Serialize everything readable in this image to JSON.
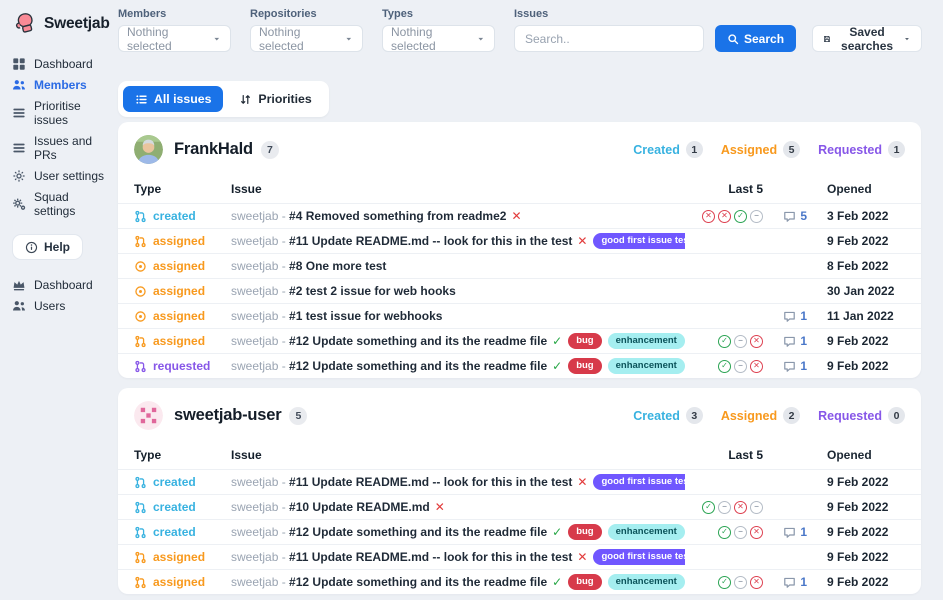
{
  "app": {
    "title": "Sweetjab"
  },
  "colors": {
    "accent": "#1a73e8",
    "created": "#38b2e0",
    "assigned": "#f8991d",
    "requested": "#8757e8"
  },
  "ui_icons": {
    "caret": "caret-down-icon",
    "search": "search-icon",
    "save": "save-icon",
    "comment": "comment-icon"
  },
  "sidebar": {
    "logo_icon": "boxing-glove-icon",
    "nav": [
      {
        "label": "Dashboard",
        "icon": "grid-icon",
        "active": false
      },
      {
        "label": "Members",
        "icon": "users-icon",
        "active": true
      },
      {
        "label": "Prioritise issues",
        "icon": "lines-icon",
        "active": false
      },
      {
        "label": "Issues and PRs",
        "icon": "lines-icon",
        "active": false
      },
      {
        "label": "User settings",
        "icon": "gear-icon",
        "active": false
      },
      {
        "label": "Squad settings",
        "icon": "gears-icon",
        "active": false
      }
    ],
    "help": {
      "label": "Help",
      "icon": "info-icon"
    },
    "admin": [
      {
        "label": "Dashboard",
        "icon": "crown-icon",
        "active": false
      },
      {
        "label": "Users",
        "icon": "users-icon",
        "active": false
      }
    ]
  },
  "filters": {
    "members": {
      "label": "Members",
      "value": "Nothing selected"
    },
    "repositories": {
      "label": "Repositories",
      "value": "Nothing selected"
    },
    "types": {
      "label": "Types",
      "value": "Nothing selected"
    },
    "issues": {
      "label": "Issues",
      "placeholder": "Search.."
    },
    "search_button": "Search",
    "saved_searches": "Saved searches"
  },
  "tabs": [
    {
      "label": "All issues",
      "icon": "list-check-icon",
      "active": true
    },
    {
      "label": "Priorities",
      "icon": "sort-icon",
      "active": false
    }
  ],
  "table_columns": [
    "Type",
    "Issue",
    "Last 5",
    "Opened"
  ],
  "label_palette": {
    "bug": {
      "bg": "#d73a4a",
      "fg": "#ffffff"
    },
    "enhancement": {
      "bg": "#a5eef0",
      "fg": "#0b535a"
    },
    "good first issue test": {
      "bg": "#7057ff",
      "fg": "#ffffff"
    }
  },
  "users": [
    {
      "name": "FrankHald",
      "issue_count": "7",
      "avatar": "photo-avatar",
      "stats": [
        {
          "label": "Created",
          "value": "1"
        },
        {
          "label": "Assigned",
          "value": "5"
        },
        {
          "label": "Requested",
          "value": "1"
        }
      ],
      "rows": [
        {
          "type": "created",
          "icon": "pull-request-icon",
          "repo": "sweetjab",
          "title": "#4 Removed something from readme2",
          "mark": "x",
          "labels": [],
          "checks": [
            "x",
            "x",
            "check",
            "minus"
          ],
          "comments": "5",
          "opened": "3 Feb 2022"
        },
        {
          "type": "assigned",
          "icon": "pull-request-icon",
          "repo": "sweetjab",
          "title": "#11 Update README.md -- look for this in the test",
          "mark": "x",
          "labels": [
            "good first issue test"
          ],
          "checks": [],
          "comments": "",
          "opened": "9 Feb 2022"
        },
        {
          "type": "assigned",
          "icon": "issue-icon",
          "repo": "sweetjab",
          "title": "#8 One more test",
          "mark": "",
          "labels": [],
          "checks": [],
          "comments": "",
          "opened": "8 Feb 2022"
        },
        {
          "type": "assigned",
          "icon": "issue-icon",
          "repo": "sweetjab",
          "title": "#2 test 2 issue for web hooks",
          "mark": "",
          "labels": [],
          "checks": [],
          "comments": "",
          "opened": "30 Jan 2022"
        },
        {
          "type": "assigned",
          "icon": "issue-icon",
          "repo": "sweetjab",
          "title": "#1 test issue for webhooks",
          "mark": "",
          "labels": [],
          "checks": [],
          "comments": "1",
          "opened": "11 Jan 2022"
        },
        {
          "type": "assigned",
          "icon": "pull-request-icon",
          "repo": "sweetjab",
          "title": "#12 Update something and its the readme file",
          "mark": "check",
          "labels": [
            "bug",
            "enhancement"
          ],
          "checks": [
            "check",
            "minus",
            "x"
          ],
          "comments": "1",
          "opened": "9 Feb 2022"
        },
        {
          "type": "requested",
          "icon": "pull-request-icon",
          "repo": "sweetjab",
          "title": "#12 Update something and its the readme file",
          "mark": "check",
          "labels": [
            "bug",
            "enhancement"
          ],
          "checks": [
            "check",
            "minus",
            "x"
          ],
          "comments": "1",
          "opened": "9 Feb 2022"
        }
      ]
    },
    {
      "name": "sweetjab-user",
      "issue_count": "5",
      "avatar": "identicon-avatar",
      "stats": [
        {
          "label": "Created",
          "value": "3"
        },
        {
          "label": "Assigned",
          "value": "2"
        },
        {
          "label": "Requested",
          "value": "0"
        }
      ],
      "rows": [
        {
          "type": "created",
          "icon": "pull-request-icon",
          "repo": "sweetjab",
          "title": "#11 Update README.md -- look for this in the test",
          "mark": "x",
          "labels": [
            "good first issue test"
          ],
          "checks": [],
          "comments": "",
          "opened": "9 Feb 2022"
        },
        {
          "type": "created",
          "icon": "pull-request-icon",
          "repo": "sweetjab",
          "title": "#10 Update README.md",
          "mark": "x",
          "labels": [],
          "checks": [
            "check",
            "minus",
            "x",
            "minus"
          ],
          "comments": "",
          "opened": "9 Feb 2022"
        },
        {
          "type": "created",
          "icon": "pull-request-icon",
          "repo": "sweetjab",
          "title": "#12 Update something and its the readme file",
          "mark": "check",
          "labels": [
            "bug",
            "enhancement"
          ],
          "checks": [
            "check",
            "minus",
            "x"
          ],
          "comments": "1",
          "opened": "9 Feb 2022"
        },
        {
          "type": "assigned",
          "icon": "pull-request-icon",
          "repo": "sweetjab",
          "title": "#11 Update README.md -- look for this in the test",
          "mark": "x",
          "labels": [
            "good first issue test"
          ],
          "checks": [],
          "comments": "",
          "opened": "9 Feb 2022"
        },
        {
          "type": "assigned",
          "icon": "pull-request-icon",
          "repo": "sweetjab",
          "title": "#12 Update something and its the readme file",
          "mark": "check",
          "labels": [
            "bug",
            "enhancement"
          ],
          "checks": [
            "check",
            "minus",
            "x"
          ],
          "comments": "1",
          "opened": "9 Feb 2022"
        }
      ]
    }
  ]
}
